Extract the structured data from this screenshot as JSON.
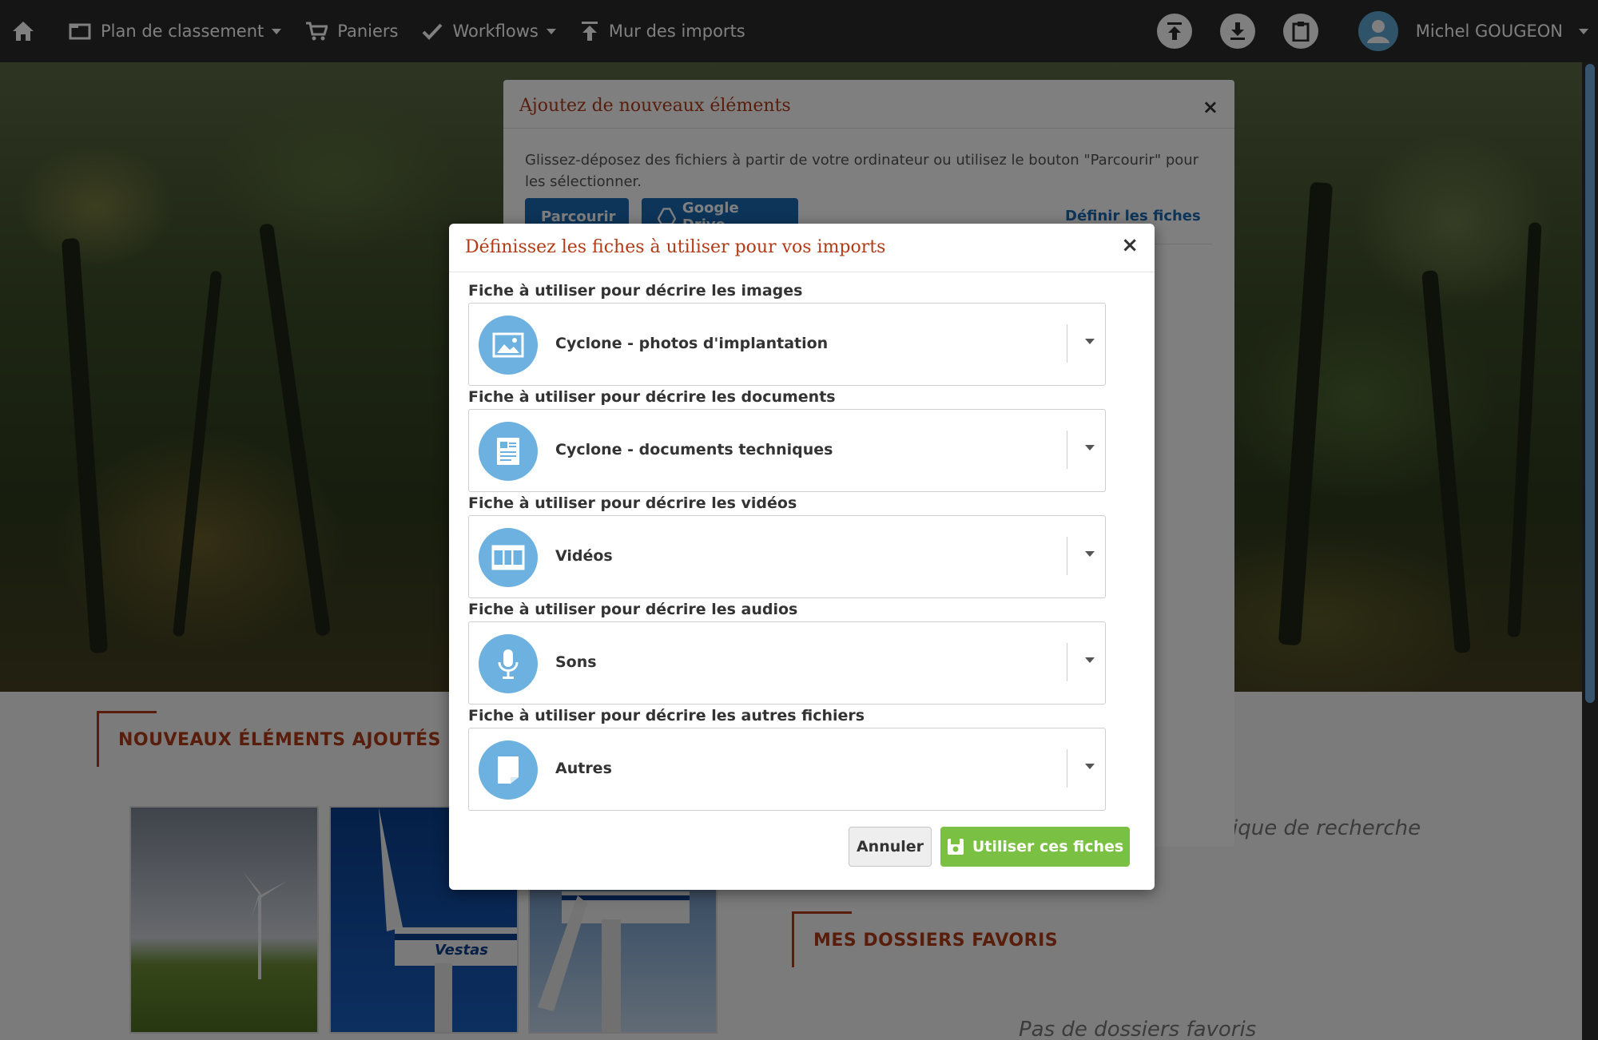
{
  "navbar": {
    "items": [
      {
        "label": "Plan de classement",
        "icon": "folder-icon",
        "has_caret": true
      },
      {
        "label": "Paniers",
        "icon": "cart-icon",
        "has_caret": false
      },
      {
        "label": "Workflows",
        "icon": "check-icon",
        "has_caret": true
      },
      {
        "label": "Mur des imports",
        "icon": "upload-icon",
        "has_caret": false
      }
    ],
    "user_name": "Michel GOUGEON"
  },
  "background_modal": {
    "title": "Ajoutez de nouveaux éléments",
    "description": "Glissez-déposez des fichiers à partir de votre ordinateur ou utilisez le bouton \"Parcourir\" pour les sélectionner.",
    "browse_label": "Parcourir",
    "google_drive_label": "Google Drive",
    "define_link": "Définir les fiches"
  },
  "page": {
    "new_items_title": "NOUVEAUX ÉLÉMENTS AJOUTÉS",
    "favorites_title": "MES DOSSIERS FAVORIS",
    "search_hint_fragment": "ique de recherche",
    "no_favorites": "Pas de dossiers favoris",
    "thumbnail_brand": "Vestas"
  },
  "modal": {
    "title": "Définissez les fiches à utiliser pour vos imports",
    "fields": [
      {
        "label": "Fiche à utiliser pour décrire les images",
        "value": "Cyclone - photos d'implantation",
        "icon": "image-icon"
      },
      {
        "label": "Fiche à utiliser pour décrire les documents",
        "value": "Cyclone - documents techniques",
        "icon": "document-icon"
      },
      {
        "label": "Fiche à utiliser pour décrire les vidéos",
        "value": "Vidéos",
        "icon": "film-icon"
      },
      {
        "label": "Fiche à utiliser pour décrire les audios",
        "value": "Sons",
        "icon": "microphone-icon"
      },
      {
        "label": "Fiche à utiliser pour décrire les autres fichiers",
        "value": "Autres",
        "icon": "file-icon"
      }
    ],
    "cancel_label": "Annuler",
    "submit_label": "Utiliser ces fiches"
  },
  "colors": {
    "accent_red": "#b23a17",
    "primary_blue": "#1a6bb4",
    "icon_blue": "#6cb1df",
    "success_green": "#7ac143",
    "navbar_bg": "#2b2b2b"
  }
}
